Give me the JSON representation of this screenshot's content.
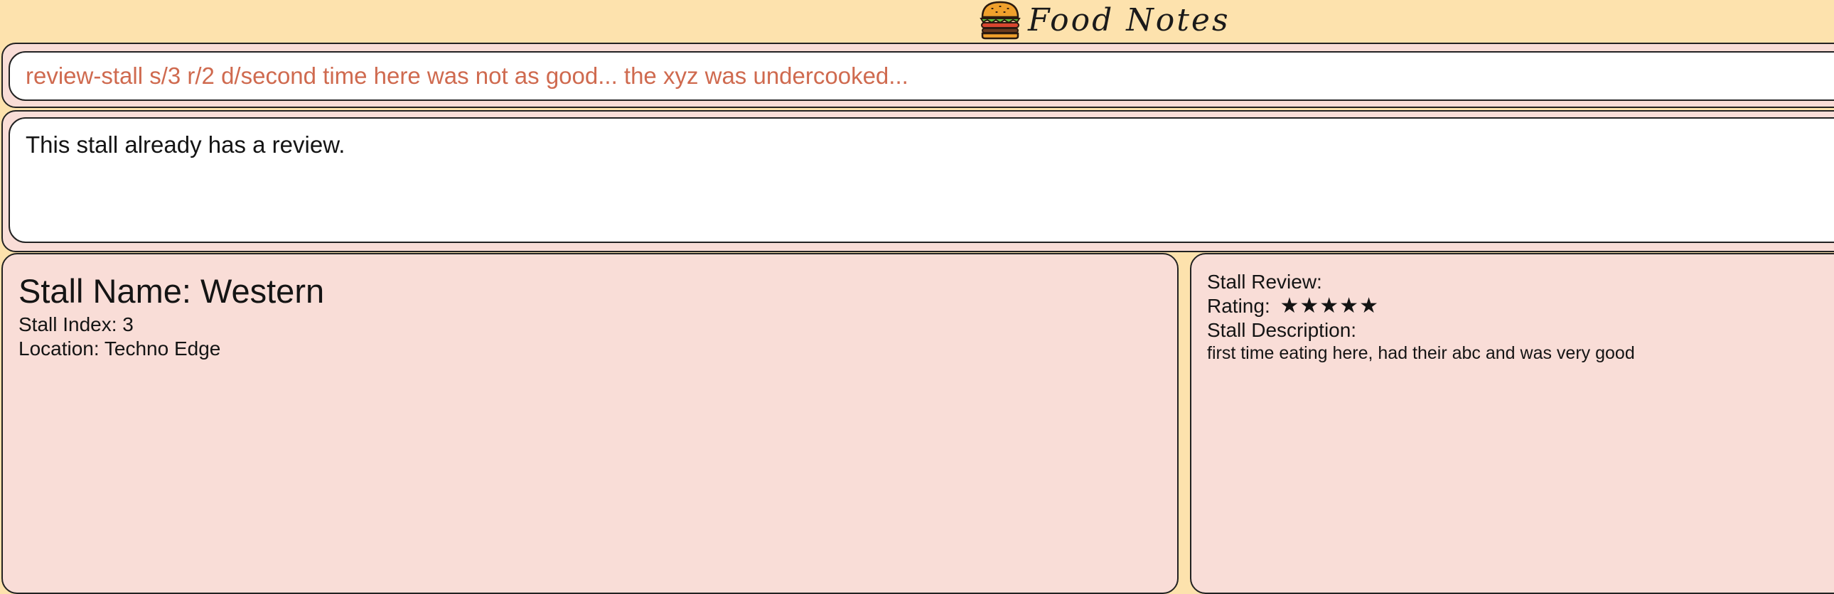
{
  "app": {
    "title": "Food Notes",
    "logo_icon": "burger-icon"
  },
  "command_box": {
    "value": "review-stall s/3 r/2 d/second time here was not as good... the xyz was undercooked...",
    "text_color": "#cf6a4f"
  },
  "result_display": {
    "message": "This stall already has a review."
  },
  "stall": {
    "name_label": "Stall Name: Western",
    "index_label": "Stall Index: 3",
    "location_label": "Location: Techno Edge"
  },
  "review": {
    "heading": "Stall Review:",
    "rating_label": "Rating:",
    "rating_stars": "★★★★★",
    "rating_value": 5,
    "description_heading": "Stall Description:",
    "description_text": "first time eating here, had their abc and was very good"
  },
  "colors": {
    "window_background": "#fde2ad",
    "panel_background": "#f9ddd7",
    "box_background": "#ffffff",
    "border": "#222222"
  }
}
